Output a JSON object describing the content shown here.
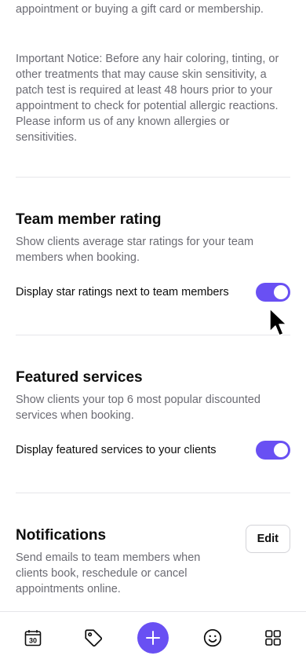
{
  "booking_notes": {
    "intro_tail": "appointment or buying a gift card or membership.",
    "notice": "Important Notice: Before any hair coloring, tinting, or other treatments that may cause skin sensitivity, a patch test is required at least 48 hours prior to your appointment to check for potential allergic reactions. Please inform us of any known allergies or sensitivities."
  },
  "team_rating": {
    "title": "Team member rating",
    "description": "Show clients average star ratings for your team members when booking.",
    "toggle_label": "Display star ratings next to team members",
    "enabled": true
  },
  "featured_services": {
    "title": "Featured services",
    "description": "Show clients your top 6 most popular discounted services when booking.",
    "toggle_label": "Display featured services to your clients",
    "enabled": true
  },
  "notifications": {
    "title": "Notifications",
    "description": "Send emails to team members when clients book, reschedule or cancel appointments online.",
    "edit_label": "Edit"
  },
  "bottom_nav": {
    "calendar_day": "30",
    "items": [
      "calendar-icon",
      "tag-icon",
      "plus-icon",
      "smiley-icon",
      "grid-icon"
    ]
  },
  "colors": {
    "accent": "#6950f3",
    "text": "#0d0d0d",
    "muted": "#6b6b73",
    "divider": "#e6e6ea"
  }
}
